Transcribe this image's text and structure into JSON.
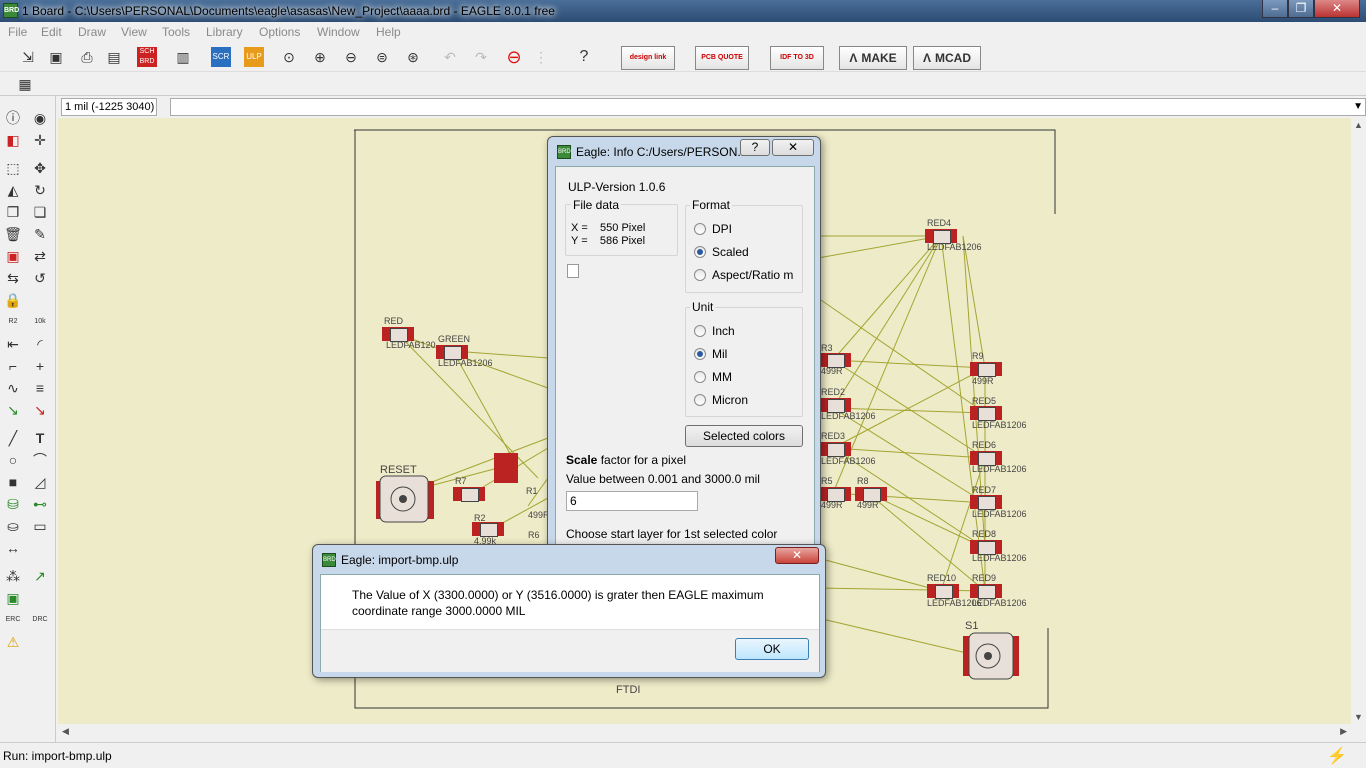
{
  "window": {
    "title": "1 Board - C:\\Users\\PERSONAL\\Documents\\eagle\\asasas\\New_Project\\aaaa.brd - EAGLE 8.0.1 free",
    "minimize": "–",
    "maximize": "❐",
    "close": "✕"
  },
  "menu": [
    "File",
    "Edit",
    "Draw",
    "View",
    "Tools",
    "Library",
    "Options",
    "Window",
    "Help"
  ],
  "toolbar": {
    "design_link": "design link",
    "pcb_quote": "PCB QUOTE",
    "idf": "IDF TO 3D",
    "make": "MAKE",
    "mcad": "MCAD"
  },
  "coord_display": "1 mil (-1225 3040)",
  "status": "Run: import-bmp.ulp",
  "canvas_labels": {
    "red": "RED",
    "red_pkg": "LEDFAB120",
    "green": "GREEN",
    "green_pkg": "LEDFAB1206",
    "reset": "RESET",
    "r7": "R7",
    "r2": "R2",
    "r2val": "4.99k",
    "r1": "R1",
    "r1val": "499R",
    "r6": "R6",
    "red4": "RED4",
    "red4pkg": "LEDFAB1206",
    "r3": "R3",
    "r3val": "499R",
    "red2": "RED2",
    "red2pkg": "LEDFAB1206",
    "red3": "RED3",
    "red3pkg": "LEDFAB1206",
    "r5": "R5",
    "r5val": "499R",
    "r8": "R8",
    "r8val": "499R",
    "r9": "R9",
    "r9val": "499R",
    "red5": "RED5",
    "red5pkg": "LEDFAB1206",
    "red6": "RED6",
    "red6pkg": "LEDFAB1206",
    "red7": "RED7",
    "red7pkg": "LEDFAB1206",
    "red8": "RED8",
    "red8pkg": "LEDFAB1206",
    "red10": "RED10",
    "red10pkg": "LEDFAB1206",
    "red9": "RED9",
    "red9pkg": "LEDFAB1206",
    "s1": "S1",
    "ftdi": "FTDI"
  },
  "info_dialog": {
    "title": "Eagle: Info C:/Users/PERSON...",
    "help": "?",
    "close": "✕",
    "ulp_version": "ULP-Version 1.0.6",
    "file_data_label": "File data",
    "x_line": "X =    550 Pixel",
    "y_line": "Y =    586 Pixel",
    "format_label": "Format",
    "format_options": [
      "DPI",
      "Scaled",
      "Aspect/Ratio m"
    ],
    "format_selected": "Scaled",
    "unit_label": "Unit",
    "unit_options": [
      "Inch",
      "Mil",
      "MM",
      "Micron"
    ],
    "unit_selected": "Mil",
    "selected_colors": "Selected colors",
    "scale_bold": "Scale",
    "scale_rest": " factor for a pixel",
    "value_between": "Value between 0.001 and 3000.0 mil",
    "scale_value": "6",
    "choose_layer": "Choose start layer for  1st selected color"
  },
  "error_dialog": {
    "title": "Eagle: import-bmp.ulp",
    "close": "✕",
    "message": "The Value of X (3300.0000) or Y (3516.0000) is grater then EAGLE maximum coordinate range 3000.0000 MIL",
    "ok": "OK"
  },
  "colors": {
    "canvas": "#eeecc8",
    "pad": "#b22222",
    "airwire": "#a4a433",
    "accent": "#3c7fb1"
  }
}
